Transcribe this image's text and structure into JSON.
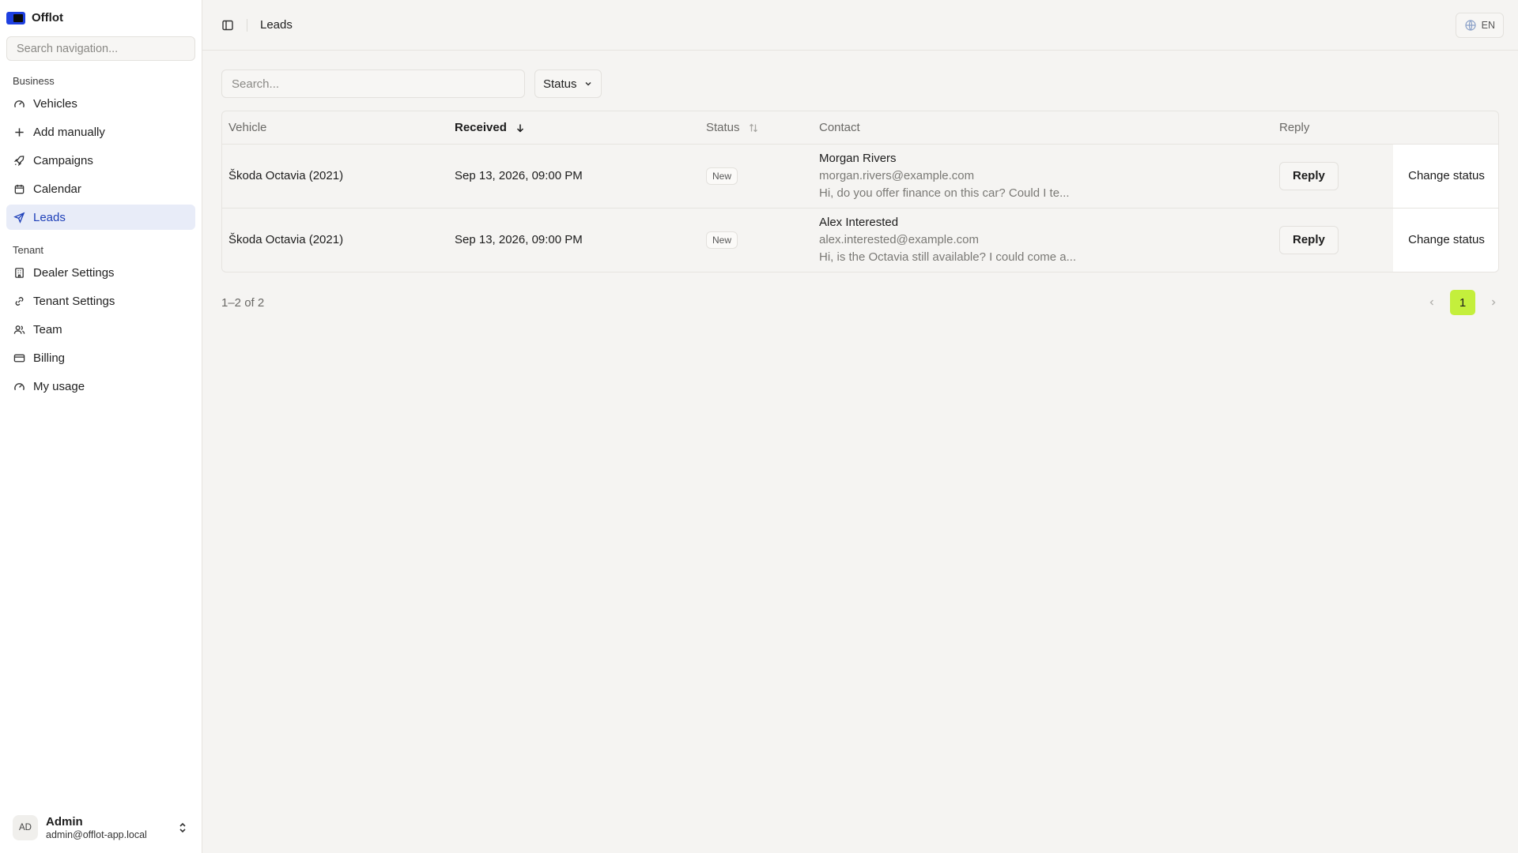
{
  "brand": {
    "name": "Offlot"
  },
  "sidebar": {
    "search_placeholder": "Search navigation...",
    "sections": [
      {
        "label": "Business"
      },
      {
        "label": "Tenant"
      }
    ],
    "business_items": [
      {
        "label": "Vehicles",
        "icon": "gauge-icon"
      },
      {
        "label": "Add manually",
        "icon": "plus-icon"
      },
      {
        "label": "Campaigns",
        "icon": "rocket-icon"
      },
      {
        "label": "Calendar",
        "icon": "calendar-icon"
      },
      {
        "label": "Leads",
        "icon": "send-icon",
        "active": true
      }
    ],
    "tenant_items": [
      {
        "label": "Dealer Settings",
        "icon": "building-icon"
      },
      {
        "label": "Tenant Settings",
        "icon": "link-icon"
      },
      {
        "label": "Team",
        "icon": "users-icon"
      },
      {
        "label": "Billing",
        "icon": "credit-card-icon"
      },
      {
        "label": "My usage",
        "icon": "gauge-icon"
      }
    ],
    "user": {
      "initials": "AD",
      "name": "Admin",
      "email": "admin@offlot-app.local"
    }
  },
  "header": {
    "breadcrumb": "Leads",
    "language": "EN"
  },
  "filters": {
    "search_placeholder": "Search...",
    "status_label": "Status"
  },
  "table": {
    "columns": [
      "Vehicle",
      "Received",
      "Status",
      "Contact",
      "Reply"
    ],
    "rows": [
      {
        "vehicle": "Škoda Octavia (2021)",
        "received": "Sep 13, 2026, 09:00 PM",
        "status": "New",
        "contact_name": "Morgan Rivers",
        "contact_email": "morgan.rivers@example.com",
        "contact_message": "Hi, do you offer finance on this car? Could I te...",
        "reply_label": "Reply",
        "action_label": "Change status"
      },
      {
        "vehicle": "Škoda Octavia (2021)",
        "received": "Sep 13, 2026, 09:00 PM",
        "status": "New",
        "contact_name": "Alex Interested",
        "contact_email": "alex.interested@example.com",
        "contact_message": "Hi, is the Octavia still available? I could come a...",
        "reply_label": "Reply",
        "action_label": "Change status"
      }
    ]
  },
  "pagination": {
    "range_text": "1–2 of 2",
    "current_page": "1"
  },
  "colors": {
    "accent": "#1e40e0",
    "active_bg": "#e8ecf8",
    "page_highlight": "#c4ef3c"
  }
}
